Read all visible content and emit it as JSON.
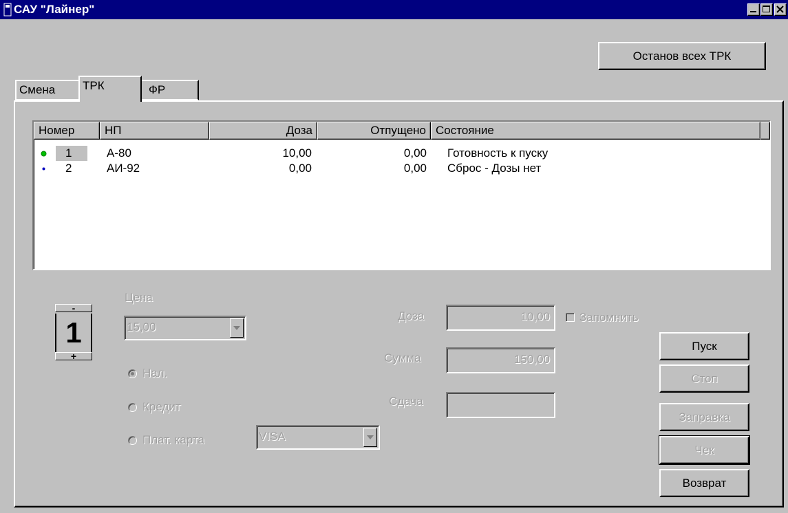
{
  "window": {
    "title": "САУ \"Лайнер\""
  },
  "toolbar": {
    "stop_all_label": "Останов всех ТРК"
  },
  "tabs": [
    {
      "label": "Смена"
    },
    {
      "label": "ТРК"
    },
    {
      "label": "ФР"
    }
  ],
  "table": {
    "columns": [
      "Номер",
      "НП",
      "Доза",
      "Отпущено",
      "Состояние"
    ],
    "rows": [
      {
        "number": "1",
        "product": "А-80",
        "dose": "10,00",
        "dispensed": "0,00",
        "state": "Готовность к пуску",
        "indicator_color": "#00c000"
      },
      {
        "number": "2",
        "product": "АИ-92",
        "dose": "0,00",
        "dispensed": "0,00",
        "state": "Сброс - Дозы нет",
        "indicator_color": "#0000c0"
      }
    ]
  },
  "dispenser": {
    "number": "1",
    "minus_label": "-",
    "plus_label": "+"
  },
  "price": {
    "label": "Цена",
    "value": "15,00"
  },
  "payment": {
    "cash_label": "Нал.",
    "credit_label": "Кредит",
    "card_label": "Плат. карта",
    "card_type": "VISA",
    "selected": "cash"
  },
  "fields": {
    "dose_label": "Доза",
    "dose_value": "10,00",
    "sum_label": "Сумма",
    "sum_value": "150,00",
    "change_label": "Сдача",
    "change_value": "",
    "remember_label": "Запомнить"
  },
  "actions": {
    "start_label": "Пуск",
    "stop_label": "Стоп",
    "fuel_label": "Заправка",
    "receipt_label": "Чек",
    "return_label": "Возврат"
  }
}
